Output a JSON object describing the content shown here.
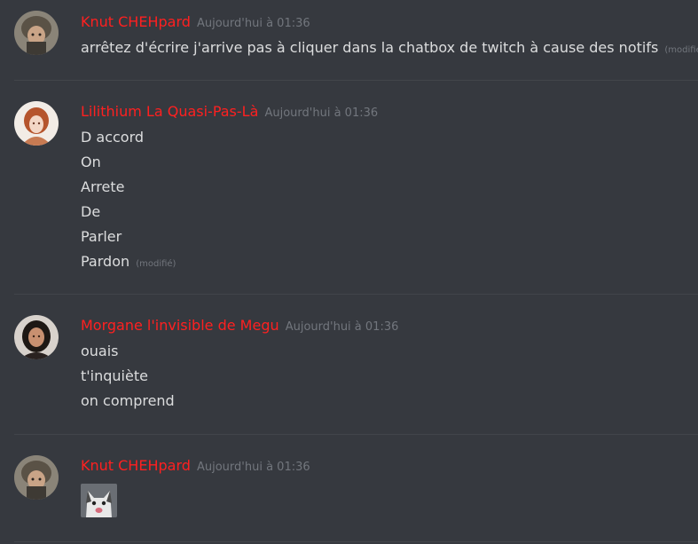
{
  "messages": [
    {
      "author": "Knut CHEHpard",
      "timestamp": "Aujourd'hui à 01:36",
      "lines": [
        {
          "text": "arrêtez d'écrire j'arrive pas à cliquer dans la chatbox de twitch à cause des notifs",
          "edited": "(modifié)"
        }
      ]
    },
    {
      "author": "Lilithium La Quasi-Pas-Là",
      "timestamp": "Aujourd'hui à 01:36",
      "lines": [
        {
          "text": "D accord"
        },
        {
          "text": "On"
        },
        {
          "text": "Arrete"
        },
        {
          "text": "De"
        },
        {
          "text": "Parler"
        },
        {
          "text": "Pardon",
          "edited": "(modifié)"
        }
      ]
    },
    {
      "author": "Morgane l'invisible de Megu",
      "timestamp": "Aujourd'hui à 01:36",
      "lines": [
        {
          "text": "ouais"
        },
        {
          "text": "t'inquiète"
        },
        {
          "text": "on comprend"
        }
      ]
    },
    {
      "author": "Knut CHEHpard",
      "timestamp": "Aujourd'hui à 01:36",
      "attachment": "cat-image"
    }
  ],
  "colors": {
    "background": "#36393f",
    "username": "#ff2020",
    "text": "#dcddde",
    "muted": "#72767d"
  }
}
